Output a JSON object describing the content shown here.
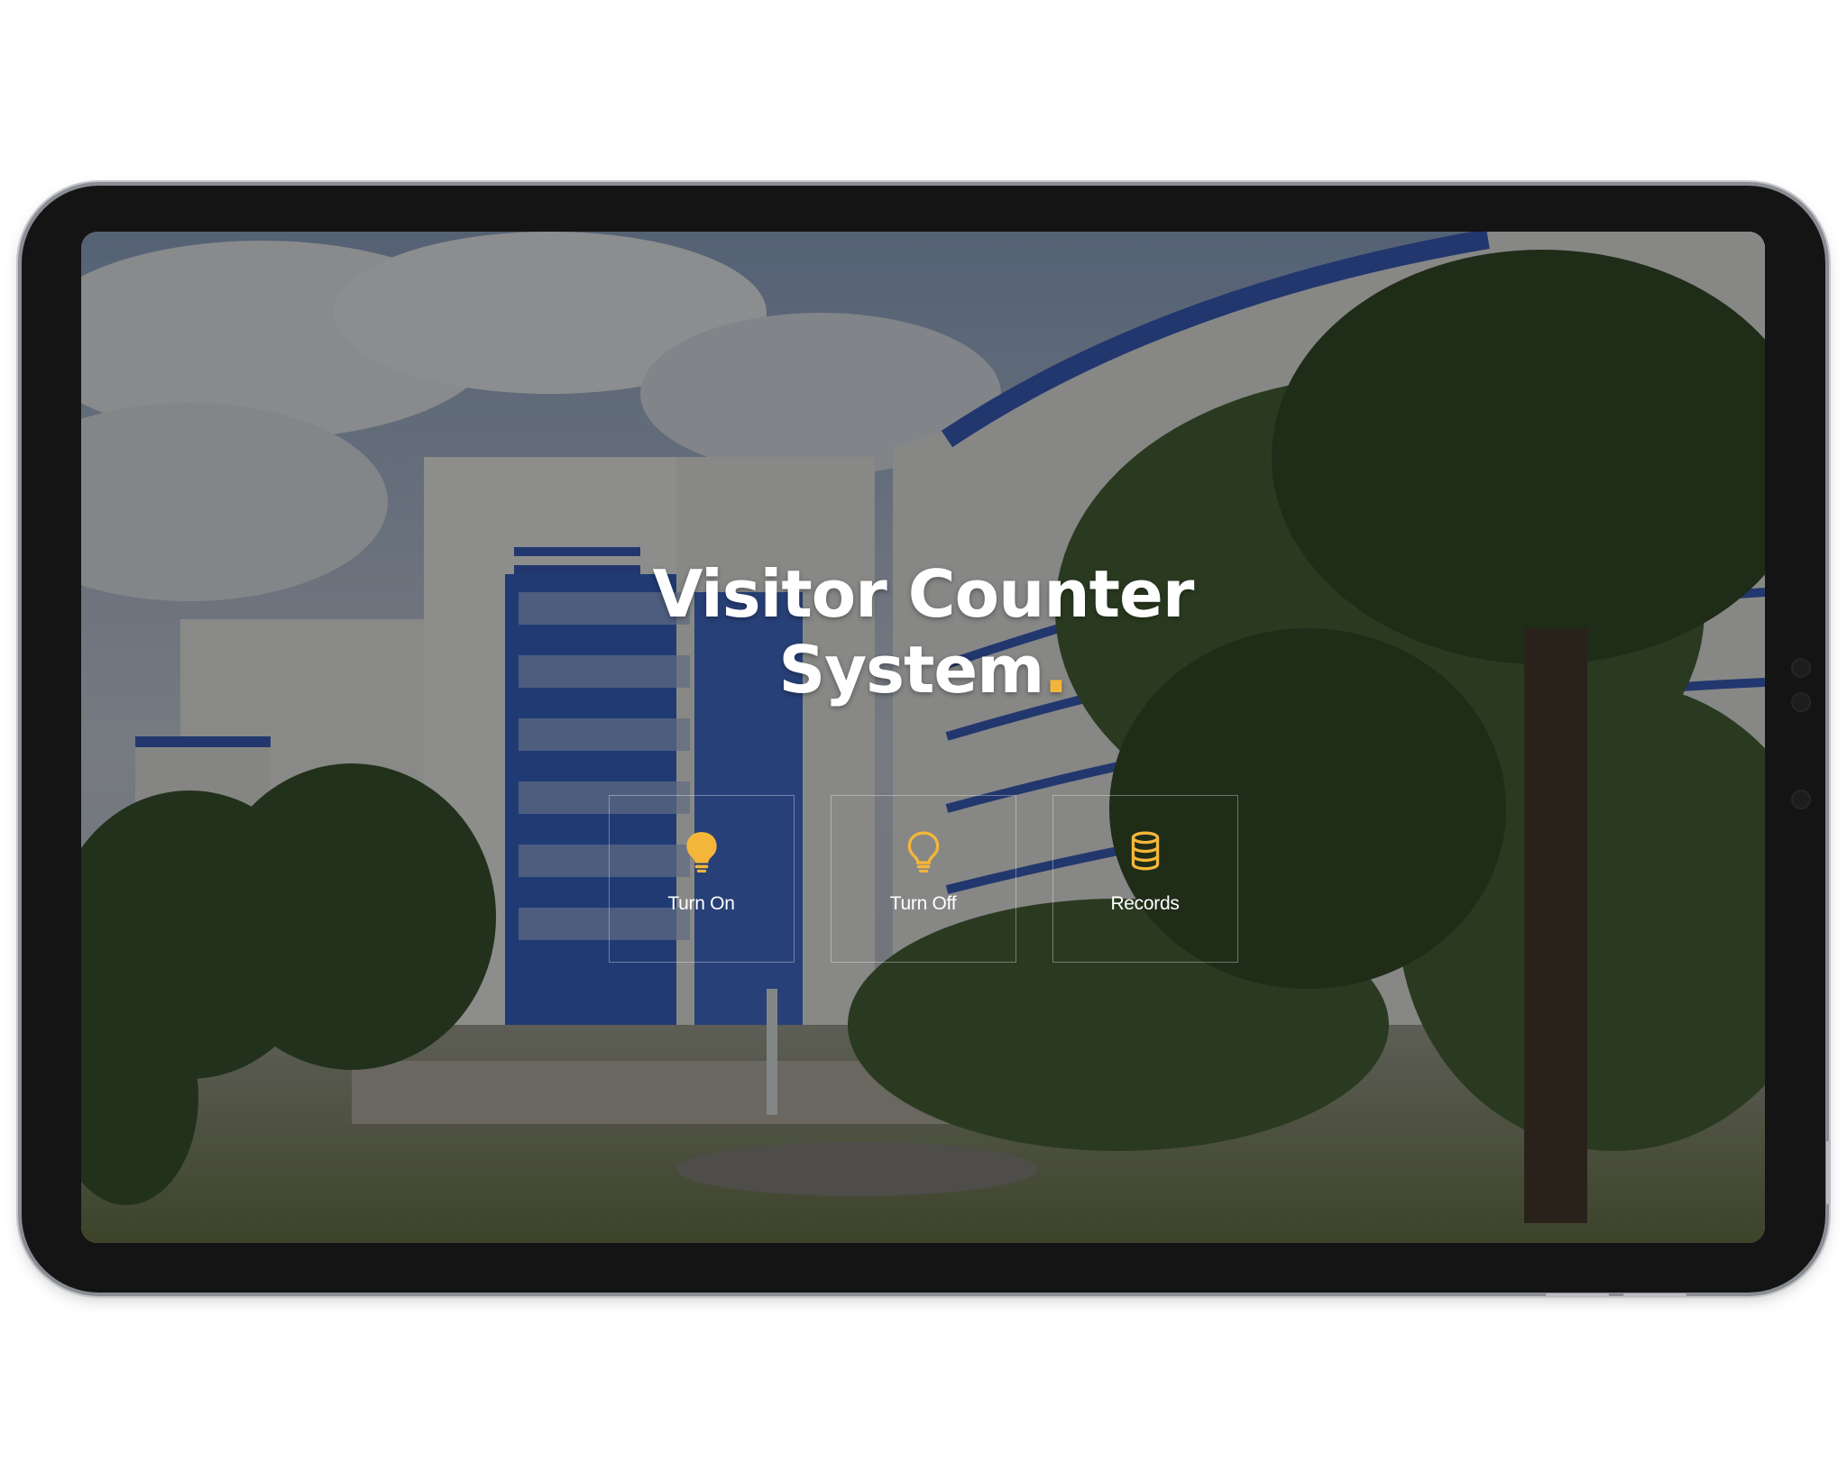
{
  "hero": {
    "title_line1": "Visitor Counter",
    "title_line2": "System",
    "title_dot": "."
  },
  "actions": [
    {
      "label": "Turn On",
      "icon": "lightbulb-filled-icon"
    },
    {
      "label": "Turn Off",
      "icon": "lightbulb-outline-icon"
    },
    {
      "label": "Records",
      "icon": "database-icon"
    }
  ],
  "colors": {
    "accent": "#f4b63a",
    "overlay": "#141414",
    "frame": "#141414",
    "text": "#ffffff"
  }
}
